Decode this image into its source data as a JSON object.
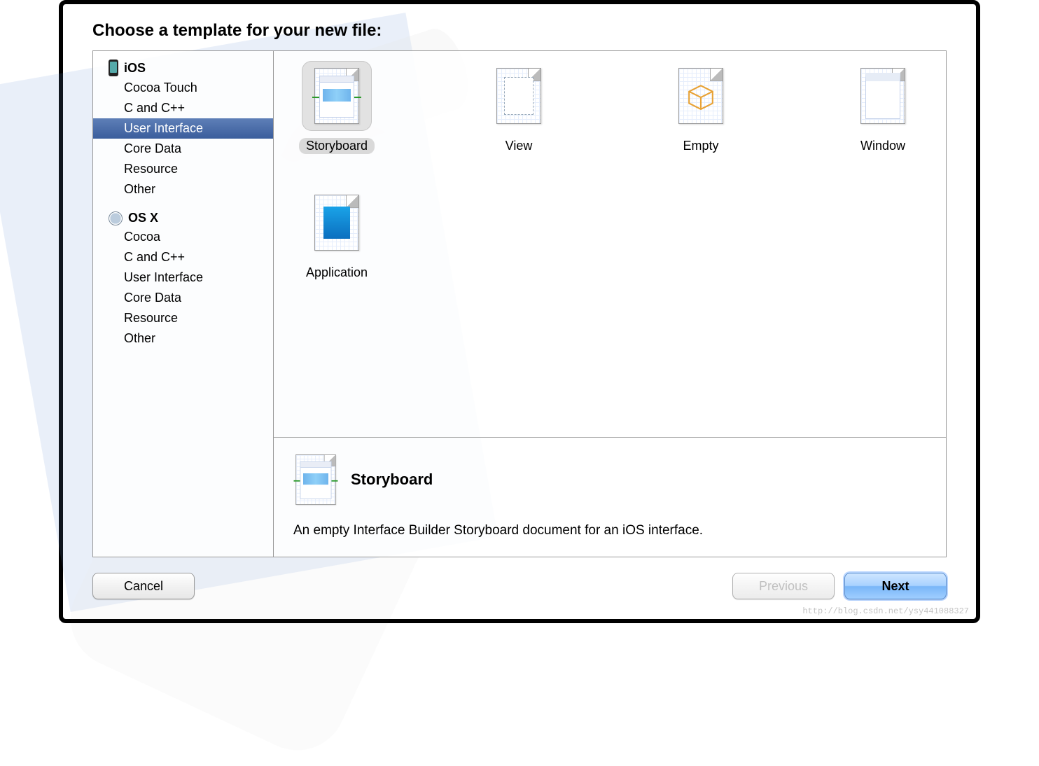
{
  "header": {
    "title": "Choose a template for your new file:"
  },
  "sidebar": {
    "groups": [
      {
        "icon": "phone-icon",
        "label": "iOS",
        "items": [
          {
            "label": "Cocoa Touch",
            "selected": false
          },
          {
            "label": "C and C++",
            "selected": false
          },
          {
            "label": "User Interface",
            "selected": true
          },
          {
            "label": "Core Data",
            "selected": false
          },
          {
            "label": "Resource",
            "selected": false
          },
          {
            "label": "Other",
            "selected": false
          }
        ]
      },
      {
        "icon": "face-icon",
        "label": "OS X",
        "items": [
          {
            "label": "Cocoa",
            "selected": false
          },
          {
            "label": "C and C++",
            "selected": false
          },
          {
            "label": "User Interface",
            "selected": false
          },
          {
            "label": "Core Data",
            "selected": false
          },
          {
            "label": "Resource",
            "selected": false
          },
          {
            "label": "Other",
            "selected": false
          }
        ]
      }
    ]
  },
  "templates": [
    {
      "id": "storyboard",
      "label": "Storyboard",
      "icon": "storyboard-icon",
      "selected": true
    },
    {
      "id": "view",
      "label": "View",
      "icon": "view-icon",
      "selected": false
    },
    {
      "id": "empty",
      "label": "Empty",
      "icon": "empty-icon",
      "selected": false
    },
    {
      "id": "window",
      "label": "Window",
      "icon": "window-icon",
      "selected": false
    },
    {
      "id": "application",
      "label": "Application",
      "icon": "application-icon",
      "selected": false
    }
  ],
  "detail": {
    "title": "Storyboard",
    "description": "An empty Interface Builder Storyboard document for an iOS interface."
  },
  "footer": {
    "cancel": "Cancel",
    "previous": "Previous",
    "next": "Next",
    "previous_enabled": false
  },
  "watermark": "http://blog.csdn.net/ysy441088327"
}
